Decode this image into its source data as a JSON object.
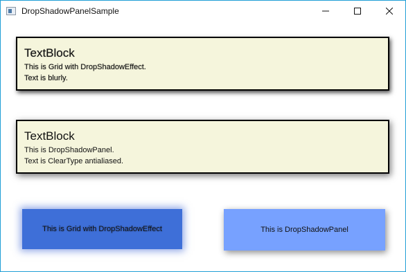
{
  "window": {
    "title": "DropShadowPanelSample",
    "icon": "app-window-icon",
    "controls": [
      "minimize-icon",
      "maximize-icon",
      "close-icon"
    ],
    "accent": "#1f9fd6"
  },
  "grid_panel": {
    "heading": "TextBlock",
    "line1": "This is Grid with DropShadowEffect.",
    "line2": "Text is blurly.",
    "background": "#f5f5dc"
  },
  "shadow_panel": {
    "heading": "TextBlock",
    "line1": "This is DropShadowPanel.",
    "line2": "Text is ClearType antialiased.",
    "background": "#f5f5dc"
  },
  "blue_grid": {
    "label": "This is Grid with DropShadowEffect",
    "background": "#3e6fd8"
  },
  "blue_shadow_panel": {
    "label": "This is DropShadowPanel",
    "background": "#77a1ff"
  }
}
